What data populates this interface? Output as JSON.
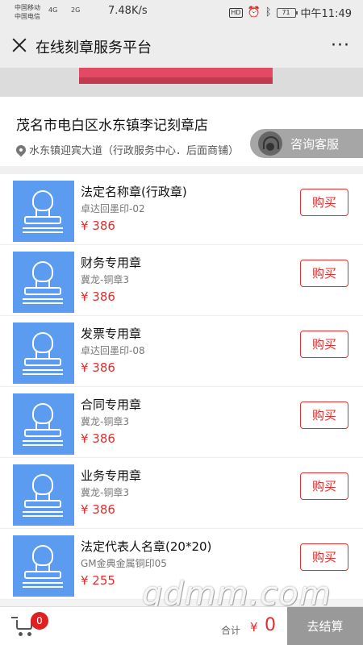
{
  "status_bar": {
    "carrier_1": "中国移动",
    "carrier_2": "中国电信",
    "signal_1": "4G",
    "signal_2": "2G",
    "speed": "7.48K/s",
    "hd": "HD",
    "battery": "71",
    "time": "中午11:49"
  },
  "title_bar": {
    "title": "在线刻章服务平台",
    "more": "···"
  },
  "shop": {
    "name": "茂名市电白区水东镇李记刻章店",
    "address": "水东镇迎宾大道（行政服务中心．后面商铺）",
    "consult_label": "咨询客服"
  },
  "products": [
    {
      "name": "法定名称章(行政章)",
      "brand": "卓达回墨印-02",
      "price": "¥ 386",
      "buy_label": "购买"
    },
    {
      "name": "财务专用章",
      "brand": "冀龙-铜章3",
      "price": "¥ 386",
      "buy_label": "购买"
    },
    {
      "name": "发票专用章",
      "brand": "卓达回墨印-08",
      "price": "¥ 386",
      "buy_label": "购买"
    },
    {
      "name": "合同专用章",
      "brand": "冀龙-铜章3",
      "price": "¥ 386",
      "buy_label": "购买"
    },
    {
      "name": "业务专用章",
      "brand": "冀龙-铜章3",
      "price": "¥ 386",
      "buy_label": "购买"
    },
    {
      "name": "法定代表人名章(20*20)",
      "brand": "GM金典金属铜印05",
      "price": "¥ 255",
      "buy_label": "购买"
    }
  ],
  "cart": {
    "count": "0",
    "total_label": "合计",
    "currency": "¥",
    "total_value": "0",
    "checkout_label": "去结算"
  },
  "watermark": "gdmm.com",
  "colors": {
    "accent": "#e02e2e",
    "thumb_blue": "#5b9bf0",
    "checkout_grey": "#999999"
  }
}
